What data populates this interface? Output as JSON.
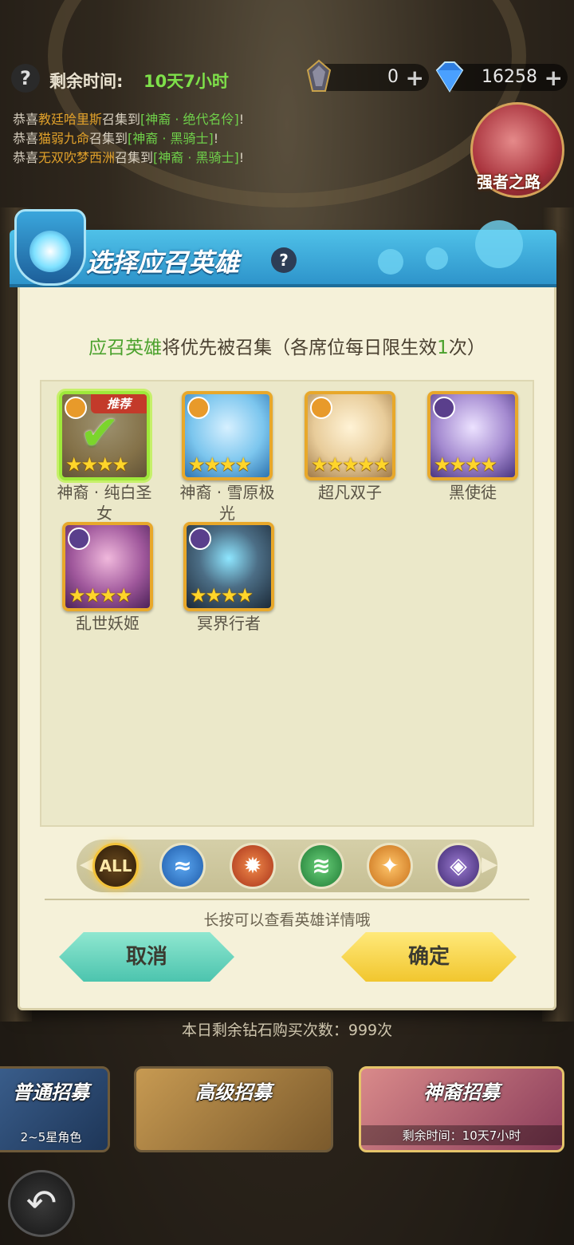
{
  "topbar": {
    "help_icon": "question-mark-icon",
    "time_label": "剩余时间:",
    "time_value": "10天7小时",
    "currency1": {
      "icon": "hourglass-crystal-icon",
      "value": "0",
      "plus": "+"
    },
    "currency2": {
      "icon": "diamond-icon",
      "value": "16258",
      "plus": "+"
    }
  },
  "ticker": [
    {
      "pre": "恭喜",
      "name": "教廷哈里斯",
      "mid": "召集到",
      "hero": "[神裔 · 绝代名伶]",
      "end": "!"
    },
    {
      "pre": "恭喜",
      "name": "猫弱九命",
      "mid": "召集到",
      "hero": "[神裔 · 黑骑士]",
      "end": "!"
    },
    {
      "pre": "恭喜",
      "name": "无双吹梦西洲",
      "mid": "召集到",
      "hero": "[神裔 · 黑骑士]",
      "end": "!"
    }
  ],
  "road_button": {
    "label": "强者之路"
  },
  "dialog": {
    "title": "选择应召英雄",
    "title_help": "?",
    "subtitle_highlight": "应召英雄",
    "subtitle_text": "将优先被召集（各席位每日限生效",
    "subtitle_num": "1",
    "subtitle_end": "次）",
    "heroes": [
      {
        "name": "神裔 · 纯白圣女",
        "stars": "★★★★",
        "selected": true,
        "badge": "推荐",
        "faction": "light",
        "color": "#d9c28a"
      },
      {
        "name": "神裔 · 雪原极光",
        "stars": "★★★★",
        "selected": false,
        "faction": "light",
        "color": "#7cc6ee"
      },
      {
        "name": "超凡双子",
        "stars": "★★★★★",
        "selected": false,
        "faction": "light",
        "color": "#e8cc9a"
      },
      {
        "name": "黑使徒",
        "stars": "★★★★",
        "selected": false,
        "faction": "dark",
        "color": "#a48ad0"
      },
      {
        "name": "乱世妖姬",
        "stars": "★★★★",
        "selected": false,
        "faction": "dark",
        "color": "#a0589c"
      },
      {
        "name": "冥界行者",
        "stars": "★★★★",
        "selected": false,
        "faction": "dark",
        "color": "#4c6e86"
      }
    ],
    "filters": [
      {
        "label": "ALL",
        "icon": "all-filter-icon"
      },
      {
        "icon": "water-faction-icon",
        "color": "#2a6fc4"
      },
      {
        "icon": "fire-faction-icon",
        "color": "#c8441e"
      },
      {
        "icon": "wind-faction-icon",
        "color": "#2f9a44"
      },
      {
        "icon": "light-faction-icon",
        "color": "#e08a1e"
      },
      {
        "icon": "dark-faction-icon",
        "color": "#5a3f8c"
      }
    ],
    "hint": "长按可以查看英雄详情哦",
    "cancel_label": "取消",
    "confirm_label": "确定"
  },
  "purchase_info": "本日剩余钻石购买次数：999次",
  "tabs": {
    "normal": {
      "title": "普通招募",
      "sub": "2~5星角色"
    },
    "advanced": {
      "title": "高级招募"
    },
    "divine": {
      "title": "神裔招募",
      "sub": "剩余时间：10天7小时"
    }
  },
  "back_icon": "back-arrow-icon"
}
